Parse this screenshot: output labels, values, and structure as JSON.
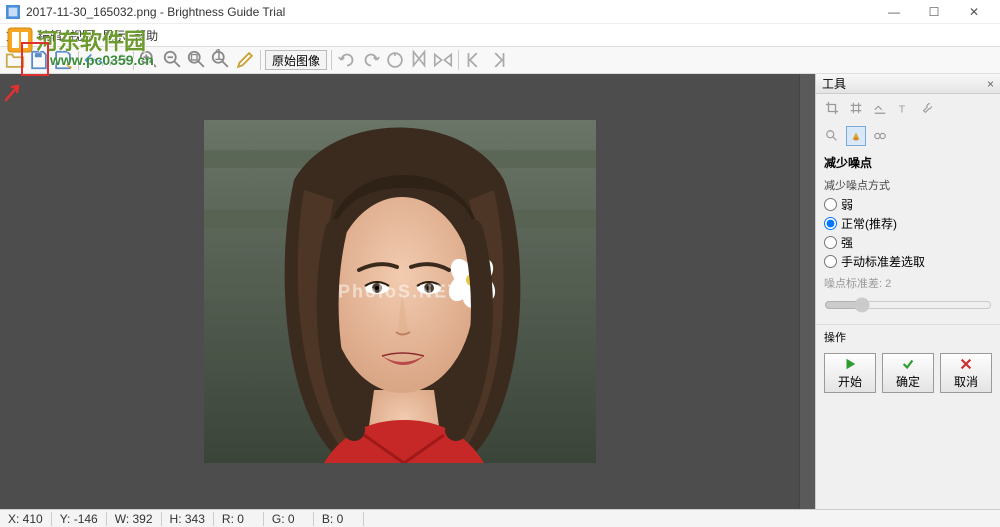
{
  "window": {
    "title": "2017-11-30_165032.png - Brightness Guide Trial",
    "min": "—",
    "max": "☐",
    "close": "✕"
  },
  "menu": {
    "items": [
      "文件",
      "编辑",
      "视图",
      "显示",
      "帮助"
    ]
  },
  "toolbar": {
    "original_label": "原始图像"
  },
  "overlay": {
    "brand": "河东软件园",
    "url": "www.pc0359.cn"
  },
  "watermark": "PholoS.NET",
  "panel": {
    "title": "工具",
    "section": "减少噪点",
    "method_label": "减少噪点方式",
    "opts": [
      "弱",
      "正常(推荐)",
      "强",
      "手动标准差选取"
    ],
    "std_label": "噪点标准差: 2",
    "actions_label": "操作",
    "start": "开始",
    "ok": "确定",
    "cancel": "取消"
  },
  "status": {
    "x": "X: 410",
    "y": "Y: -146",
    "w": "W: 392",
    "h": "H: 343",
    "r": "R: 0",
    "g": "G: 0",
    "b": "B: 0"
  }
}
